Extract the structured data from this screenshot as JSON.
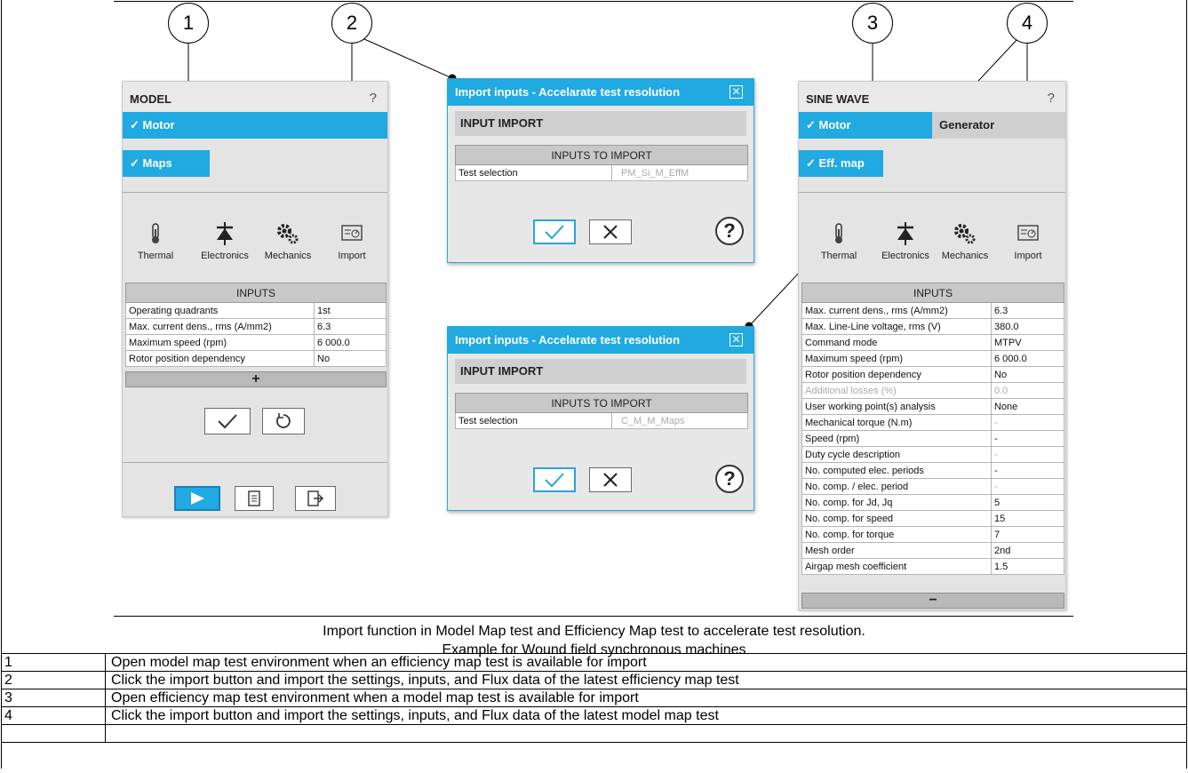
{
  "callouts": [
    "1",
    "2",
    "3",
    "4"
  ],
  "model_panel": {
    "title": "MODEL",
    "help": "?",
    "tab_motor": "✓ Motor",
    "tab_maps": "✓ Maps",
    "icons": [
      {
        "icon": "thermometer-icon",
        "label": "Thermal"
      },
      {
        "icon": "diode-icon",
        "label": "Electronics"
      },
      {
        "icon": "gears-icon",
        "label": "Mechanics"
      },
      {
        "icon": "import-icon",
        "label": "Import"
      }
    ],
    "inputs_header": "INPUTS",
    "rows": [
      {
        "label": "Operating quadrants",
        "value": "1st"
      },
      {
        "label": "Max. current dens., rms (A/mm2)",
        "value": "6.3"
      },
      {
        "label": "Maximum speed (rpm)",
        "value": "6 000.0"
      },
      {
        "label": "Rotor position dependency",
        "value": "No"
      }
    ],
    "expand": "+"
  },
  "dialog_top": {
    "title": "Import inputs - Accelarate test resolution",
    "subtitle": "INPUT IMPORT",
    "table_header": "INPUTS TO IMPORT",
    "row_label": "Test selection",
    "row_value": "PM_Si_M_EffM",
    "help": "?"
  },
  "dialog_bottom": {
    "title": "Import inputs - Accelarate test resolution",
    "subtitle": "INPUT IMPORT",
    "table_header": "INPUTS TO IMPORT",
    "row_label": "Test selection",
    "row_value": "C_M_M_Maps",
    "help": "?"
  },
  "sine_panel": {
    "title": "SINE WAVE",
    "help": "?",
    "tab_motor": "✓ Motor",
    "tab_generator": "Generator",
    "tab_effmap": "✓ Eff. map",
    "icons": [
      {
        "icon": "thermometer-icon",
        "label": "Thermal"
      },
      {
        "icon": "diode-icon",
        "label": "Electronics"
      },
      {
        "icon": "gears-icon",
        "label": "Mechanics"
      },
      {
        "icon": "import-icon",
        "label": "Import"
      }
    ],
    "inputs_header": "INPUTS",
    "rows": [
      {
        "label": "Max. current dens., rms (A/mm2)",
        "value": "6.3"
      },
      {
        "label": "Max. Line-Line voltage, rms (V)",
        "value": "380.0"
      },
      {
        "label": "Command mode",
        "value": "MTPV"
      },
      {
        "label": "Maximum speed (rpm)",
        "value": "6 000.0"
      },
      {
        "label": "Rotor position dependency",
        "value": "No"
      },
      {
        "label": "Additional losses (%)",
        "value": "0.0"
      },
      {
        "label": "User working point(s) analysis",
        "value": "None"
      },
      {
        "label": "Mechanical torque (N.m)",
        "value": "-"
      },
      {
        "label": "Speed (rpm)",
        "value": "-"
      },
      {
        "label": "Duty cycle description",
        "value": "-"
      },
      {
        "label": "No. computed elec. periods",
        "value": "-"
      },
      {
        "label": "No. comp. / elec. period",
        "value": "-"
      },
      {
        "label": "No. comp. for Jd, Jq",
        "value": "5"
      },
      {
        "label": "No. comp. for speed",
        "value": "15"
      },
      {
        "label": "No. comp. for torque",
        "value": "7"
      },
      {
        "label": "Mesh order",
        "value": "2nd"
      },
      {
        "label": "Airgap mesh coefficient",
        "value": "1.5"
      }
    ],
    "collapse": "−"
  },
  "caption": {
    "line1": "Import function in Model Map test and Efficiency Map test to accelerate test resolution.",
    "line2": "Example for Wound field synchronous machines"
  },
  "legend": [
    {
      "num": "1",
      "text": "Open model map test environment when an efficiency map test is available for import"
    },
    {
      "num": "2",
      "text": "Click the import button and import the settings, inputs, and Flux data of the latest efficiency map test"
    },
    {
      "num": "3",
      "text": "Open efficiency map test environment when a model map test is available for import"
    },
    {
      "num": "4",
      "text": "Click the import button and import the settings, inputs, and Flux data of the latest model map test"
    }
  ]
}
